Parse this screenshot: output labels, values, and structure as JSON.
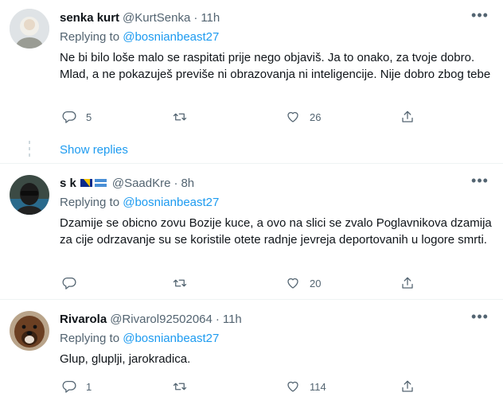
{
  "tweets": [
    {
      "name": "senka kurt",
      "handle": "@KurtSenka",
      "dot": "·",
      "time": "11h",
      "replying_prefix": "Replying to",
      "replying_to": "@bosnianbeast27",
      "text": "Ne bi bilo loše malo se raspitati prije nego objaviš. Ja to onako, za tvoje dobro. Mlad, a ne pokazuješ previše ni obrazovanja ni inteligencije. Nije dobro zbog tebe",
      "reply_count": "5",
      "retweet_count": "",
      "like_count": "26",
      "avatar_icon": "person-avatar-light"
    },
    {
      "name": "s k",
      "handle": "@SaadKre",
      "dot": "·",
      "time": "8h",
      "replying_prefix": "Replying to",
      "replying_to": "@bosnianbeast27",
      "text": "Dzamije se obicno zovu Bozije kuce, a ovo na slici se zvalo Poglavnikova dzamija za cije odrzavanje su se koristile otete radnje jevreja deportovanih u logore smrti.",
      "reply_count": "",
      "retweet_count": "",
      "like_count": "20",
      "flags": [
        "bosnia-flag-icon",
        "sandzak-flag-icon"
      ],
      "avatar_icon": "person-avatar-dark"
    },
    {
      "name": "Rivarola",
      "handle": "@Rivarol92502064",
      "dot": "·",
      "time": "11h",
      "replying_prefix": "Replying to",
      "replying_to": "@bosnianbeast27",
      "text": "Glup, gluplji, jarokradica.",
      "reply_count": "1",
      "retweet_count": "",
      "like_count": "114",
      "avatar_icon": "dog-avatar"
    }
  ],
  "show_replies": "Show replies",
  "colors": {
    "accent": "#1d9bf0",
    "secondary": "#536471",
    "divider": "#eff3f4"
  },
  "icons": [
    "reply-icon",
    "retweet-icon",
    "like-icon",
    "share-icon",
    "more-icon"
  ]
}
